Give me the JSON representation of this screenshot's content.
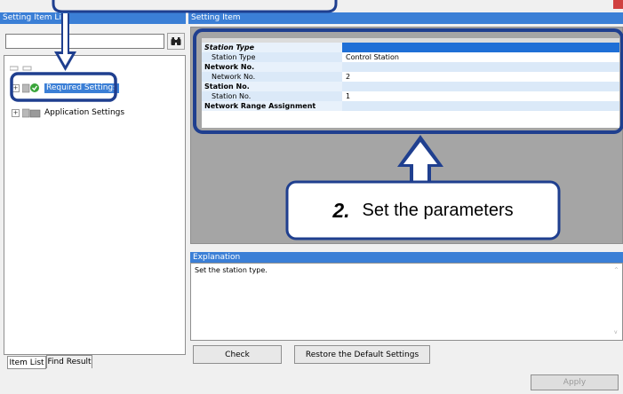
{
  "left_panel": {
    "title": "Setting Item Li",
    "search_placeholder": "",
    "tree": [
      {
        "label": "Required Settings",
        "selected": true
      },
      {
        "label": "Application Settings",
        "selected": false
      }
    ],
    "tabs": [
      "Item List",
      "Find Result"
    ]
  },
  "setting_item": {
    "title": "Setting Item",
    "rows": [
      {
        "item": "Station Type",
        "value": "",
        "kind": "cat-italic"
      },
      {
        "item": "Station Type",
        "value": "Control Station",
        "kind": "sub"
      },
      {
        "item": "Network No.",
        "value": "",
        "kind": "cat"
      },
      {
        "item": "Network No.",
        "value": "2",
        "kind": "sub"
      },
      {
        "item": "Station No.",
        "value": "",
        "kind": "cat"
      },
      {
        "item": "Station No.",
        "value": "1",
        "kind": "sub"
      },
      {
        "item": "Network Range Assignment",
        "value": "",
        "kind": "cat"
      }
    ]
  },
  "explanation": {
    "title": "Explanation",
    "text": "Set the station type."
  },
  "buttons": {
    "check": "Check",
    "restore": "Restore the Default Settings",
    "apply": "Apply"
  },
  "callout": {
    "number": "2.",
    "text": "Set the parameters"
  },
  "colors": {
    "accent": "#3b7fd6",
    "annotation": "#1f3f8f"
  }
}
